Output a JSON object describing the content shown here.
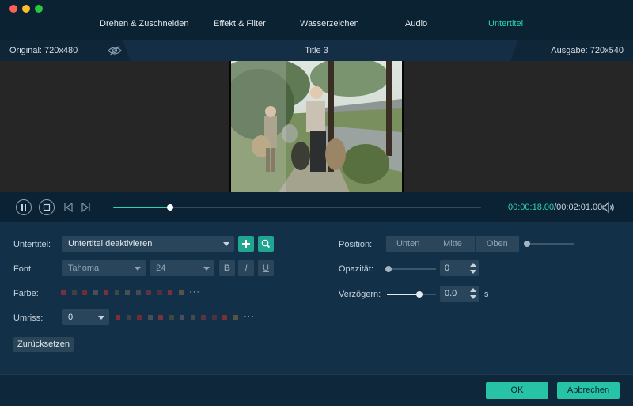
{
  "window": {
    "traffic_lights": [
      "#fe5f57",
      "#fdbc2e",
      "#28c840"
    ]
  },
  "tabs": [
    {
      "label": "Drehen & Zuschneiden",
      "active": false
    },
    {
      "label": "Effekt & Filter",
      "active": false
    },
    {
      "label": "Wasserzeichen",
      "active": false
    },
    {
      "label": "Audio",
      "active": false
    },
    {
      "label": "Untertitel",
      "active": true
    }
  ],
  "infobar": {
    "original": "Original: 720x480",
    "title": "Title 3",
    "output": "Ausgabe: 720x540",
    "eye_icon": "eye-slash-icon"
  },
  "player": {
    "progress": 0.155,
    "time_current": "00:00:18.00",
    "time_total": "/00:02:01.00",
    "icons": [
      "pause-icon",
      "stop-icon",
      "skip-back-icon",
      "skip-forward-icon",
      "volume-icon"
    ]
  },
  "subtitle": {
    "label": "Untertitel:",
    "value": "Untertitel deaktivieren",
    "add_icon": "plus-icon",
    "search_icon": "search-icon"
  },
  "font": {
    "label": "Font:",
    "family": "Tahoma",
    "size": "24",
    "bold": "B",
    "italic": "I",
    "underline": "U"
  },
  "color": {
    "label": "Farbe:",
    "swatches": [
      "#7a2f3a",
      "#3f3f44",
      "#6f2d38",
      "#454f5a",
      "#7a3040",
      "#3b4a3f",
      "#4a4f57",
      "#454a52",
      "#5a3442",
      "#4f2f44",
      "#7b2f3a",
      "#5a5145"
    ],
    "more": "···"
  },
  "outline": {
    "label": "Umriss:",
    "value": "0",
    "swatches": [
      "#7a2f3a",
      "#3f3f44",
      "#6f2d38",
      "#454f5a",
      "#7a3040",
      "#3b4a3f",
      "#4a4f57",
      "#454a52",
      "#5a3442",
      "#4f2f44",
      "#7b2f3a",
      "#5a5145"
    ],
    "more": "···"
  },
  "reset_label": "Zurücksetzen",
  "position": {
    "label": "Position:",
    "options": [
      "Unten",
      "Mitte",
      "Oben"
    ]
  },
  "opacity": {
    "label": "Opazität:",
    "value": "0",
    "level": 0
  },
  "delay": {
    "label": "Verzögern:",
    "value": "0.0",
    "unit": "s",
    "level": 0.65
  },
  "footer": {
    "ok": "OK",
    "cancel": "Abbrechen"
  },
  "colors": {
    "accent": "#2dd3b3",
    "button": "#27c3a6"
  }
}
